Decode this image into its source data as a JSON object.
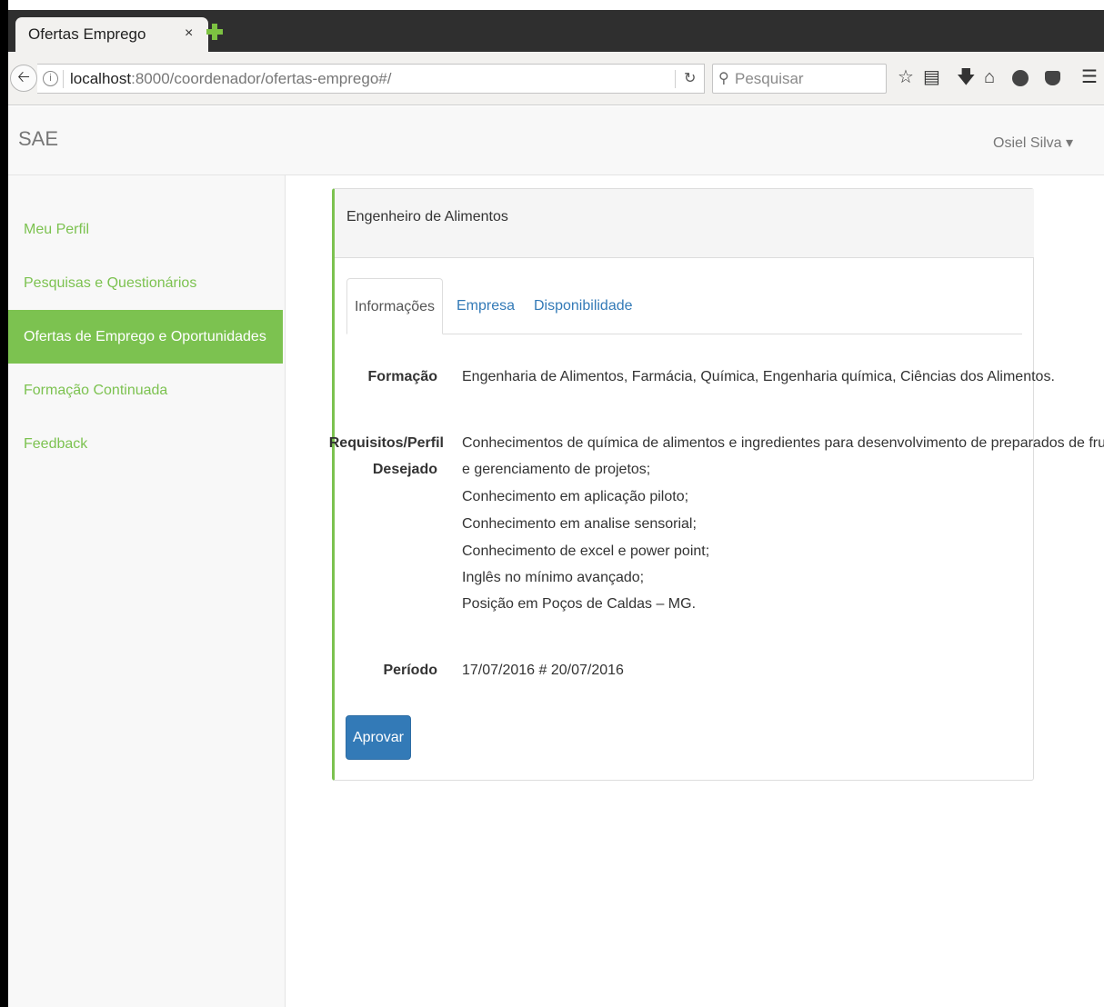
{
  "browser": {
    "tab_title": "Ofertas Emprego",
    "tab_close": "×",
    "url_host": "localhost",
    "url_rest": ":8000/coordenador/ofertas-emprego#/",
    "search_placeholder": "Pesquisar"
  },
  "app": {
    "brand": "SAE",
    "user": "Osiel Silva ▾"
  },
  "sidebar": {
    "items": [
      {
        "label": "Meu Perfil"
      },
      {
        "label": "Pesquisas e Questionários"
      },
      {
        "label": "Ofertas de Emprego e Oportunidades"
      },
      {
        "label": "Formação Continuada"
      },
      {
        "label": "Feedback"
      }
    ],
    "active_index": 2
  },
  "panel": {
    "title": "Engenheiro de Alimentos",
    "tabs": [
      {
        "label": "Informações"
      },
      {
        "label": "Empresa"
      },
      {
        "label": "Disponibilidade"
      }
    ],
    "formacao_label": "Formação",
    "formacao_value": "Engenharia de Alimentos, Farmácia, Química, Engenharia química, Ciências dos Alimentos.",
    "requisitos_label_1": "Requisitos/Perfil",
    "requisitos_label_2": "Desejado",
    "requisitos_lines": [
      "Conhecimentos de química de alimentos e ingredientes para desenvolvimento de preparados de fruta",
      "e gerenciamento de projetos;",
      "Conhecimento em aplicação piloto;",
      "Conhecimento em analise sensorial;",
      "Conhecimento de excel e power point;",
      "Inglês no mínimo avançado;",
      "Posição em Poços de Caldas – MG."
    ],
    "periodo_label": "Período",
    "periodo_value": "17/07/2016 # 20/07/2016",
    "approve_label": "Aprovar"
  },
  "colors": {
    "accent_green": "#7cc250",
    "primary_blue": "#337ab7"
  }
}
